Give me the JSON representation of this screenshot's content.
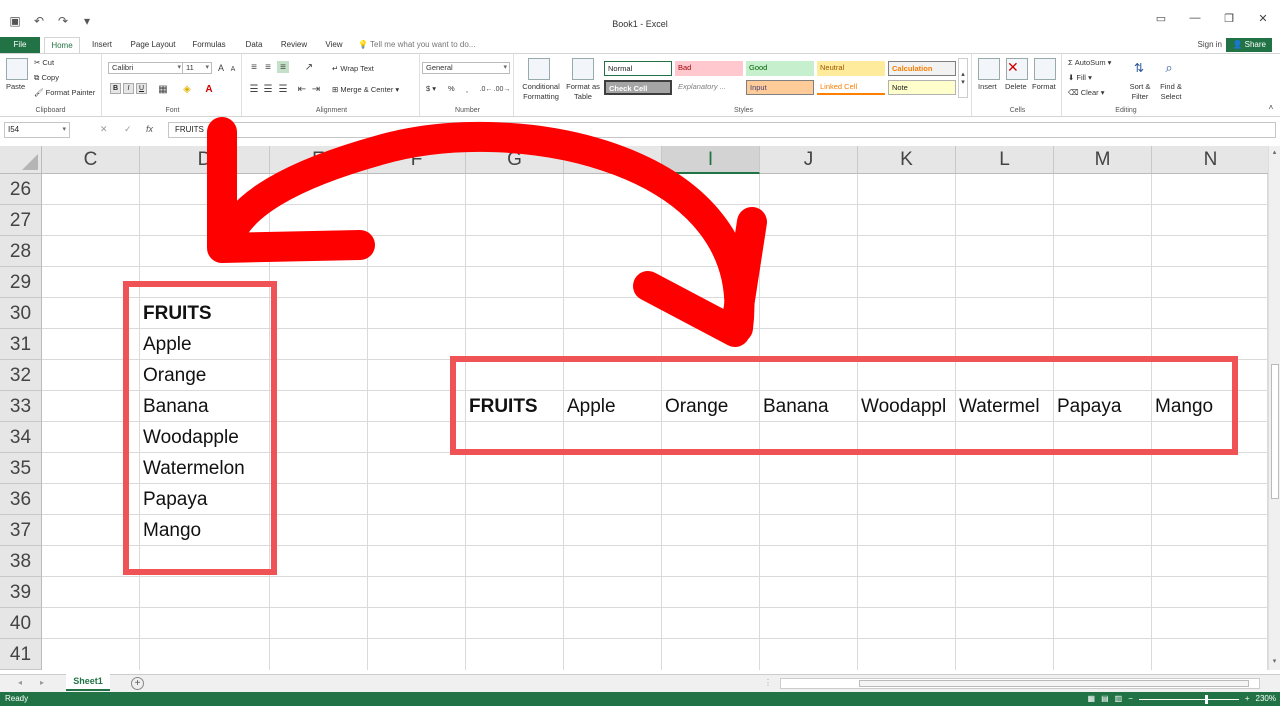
{
  "window": {
    "title": "Book1 - Excel",
    "minimize_icon": "minimize-icon",
    "restore_icon": "restore-icon",
    "close_icon": "close-icon"
  },
  "ribbon_tabs": [
    "File",
    "Home",
    "Insert",
    "Page Layout",
    "Formulas",
    "Data",
    "Review",
    "View"
  ],
  "active_tab": "Home",
  "tell_me": "Tell me what you want to do...",
  "account": {
    "signin": "Sign in",
    "share": "Share"
  },
  "clipboard": {
    "paste": "Paste",
    "cut": "Cut",
    "copy": "Copy",
    "format_painter": "Format Painter",
    "label": "Clipboard"
  },
  "font": {
    "name": "Calibri",
    "size": "11",
    "bold": "B",
    "italic": "I",
    "underline": "U",
    "label": "Font"
  },
  "alignment": {
    "wrap_text": "Wrap Text",
    "merge_center": "Merge & Center",
    "label": "Alignment"
  },
  "number": {
    "format": "General",
    "currency": "$",
    "percent": "%",
    "label": "Number"
  },
  "styles": {
    "conditional_formatting": "Conditional Formatting",
    "format_as_table": "Format as Table",
    "cells": [
      {
        "label": "Normal",
        "bg": "#ffffff",
        "color": "#000000"
      },
      {
        "label": "Bad",
        "bg": "#ffc7ce",
        "color": "#9c0006"
      },
      {
        "label": "Good",
        "bg": "#c6efce",
        "color": "#006100"
      },
      {
        "label": "Neutral",
        "bg": "#ffeb9c",
        "color": "#9c5700"
      },
      {
        "label": "Calculation",
        "bg": "#f2f2f2",
        "color": "#fa7d00"
      },
      {
        "label": "Check Cell",
        "bg": "#a5a5a5",
        "color": "#ffffff"
      },
      {
        "label": "Explanatory ...",
        "bg": "#ffffff",
        "color": "#7f7f7f"
      },
      {
        "label": "Input",
        "bg": "#ffcc99",
        "color": "#3f3f76"
      },
      {
        "label": "Linked Cell",
        "bg": "#ffffff",
        "color": "#fa7d00"
      },
      {
        "label": "Note",
        "bg": "#ffffcc",
        "color": "#000000"
      }
    ],
    "label": "Styles"
  },
  "cells_group": {
    "insert": "Insert",
    "delete": "Delete",
    "format": "Format",
    "label": "Cells"
  },
  "editing": {
    "autosum": "AutoSum",
    "fill": "Fill",
    "clear": "Clear",
    "sort_filter": "Sort & Filter",
    "find_select": "Find & Select",
    "label": "Editing"
  },
  "formula_bar": {
    "name_box": "I54",
    "cancel": "✕",
    "enter": "✓",
    "fx": "fx",
    "value": "FRUITS"
  },
  "grid": {
    "columns": [
      "C",
      "D",
      "E",
      "F",
      "G",
      "H",
      "I",
      "J",
      "K",
      "L",
      "M",
      "N"
    ],
    "selected_column": "I",
    "rows": [
      "26",
      "27",
      "28",
      "29",
      "30",
      "31",
      "32",
      "33",
      "34",
      "35",
      "36",
      "37",
      "38",
      "39",
      "40",
      "41"
    ]
  },
  "vertical_list": [
    "FRUITS",
    "Apple",
    "Orange",
    "Banana",
    "Woodapple",
    "Watermelon",
    "Papaya",
    "Mango"
  ],
  "horizontal_list": [
    "FRUITS",
    "Apple",
    "Orange",
    "Banana",
    "Woodappl",
    "Watermel",
    "Papaya",
    "Mango"
  ],
  "highlight_color": "#f05355",
  "arrow_color": "#ff0000",
  "accent_color": "#217346",
  "sheet_tabs": [
    "Sheet1"
  ],
  "status": {
    "text": "Ready",
    "zoom": "230%"
  }
}
